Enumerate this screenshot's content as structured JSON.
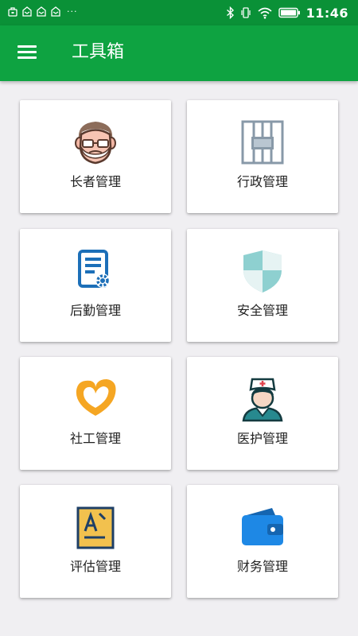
{
  "status_bar": {
    "time": "11:46",
    "overflow_dots": "···"
  },
  "app_bar": {
    "title": "工具箱",
    "menu_icon": "hamburger-menu-icon"
  },
  "colors": {
    "app_bar": "#0ea341",
    "status_bar": "#0a9137",
    "background": "#f0eff2"
  },
  "tools": [
    {
      "label": "长者管理",
      "icon": "elder-face-icon"
    },
    {
      "label": "行政管理",
      "icon": "window-bars-icon"
    },
    {
      "label": "后勤管理",
      "icon": "document-gear-icon"
    },
    {
      "label": "安全管理",
      "icon": "shield-icon"
    },
    {
      "label": "社工管理",
      "icon": "heart-icon"
    },
    {
      "label": "医护管理",
      "icon": "nurse-icon"
    },
    {
      "label": "评估管理",
      "icon": "assessment-document-icon"
    },
    {
      "label": "财务管理",
      "icon": "wallet-icon"
    }
  ]
}
